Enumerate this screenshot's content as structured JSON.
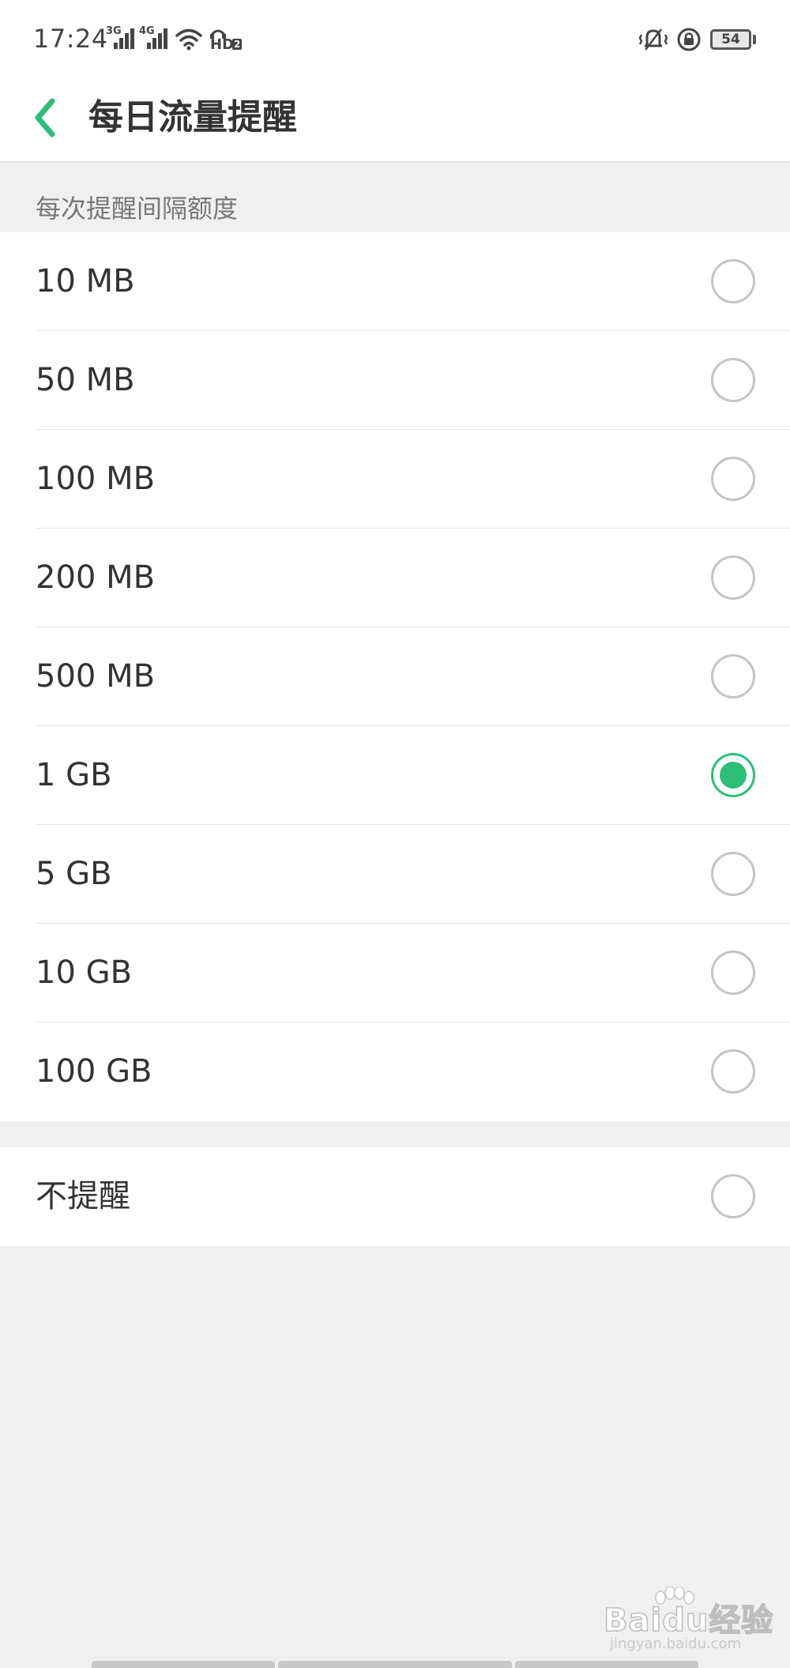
{
  "status_bar": {
    "time": "17:24",
    "signal1_label": "3G",
    "signal2_label": "4G",
    "hd_label": "HD",
    "hd_sub": "2",
    "battery_level": "54",
    "icons": [
      "signal-icon",
      "wifi-icon",
      "hd-voice-icon",
      "vibrate-icon",
      "rotation-lock-icon",
      "battery-icon"
    ]
  },
  "header": {
    "title": "每日流量提醒",
    "back_icon": "chevron-left-icon",
    "accent_color": "#2dbe78"
  },
  "section": {
    "label": "每次提醒间隔额度"
  },
  "options": [
    {
      "label": "10 MB",
      "selected": false
    },
    {
      "label": "50 MB",
      "selected": false
    },
    {
      "label": "100 MB",
      "selected": false
    },
    {
      "label": "200 MB",
      "selected": false
    },
    {
      "label": "500 MB",
      "selected": false
    },
    {
      "label": "1 GB",
      "selected": true
    },
    {
      "label": "5 GB",
      "selected": false
    },
    {
      "label": "10 GB",
      "selected": false
    },
    {
      "label": "100 GB",
      "selected": false
    }
  ],
  "no_reminder": {
    "label": "不提醒",
    "selected": false
  },
  "watermark": {
    "logo_text": "Baidu经验",
    "url_text": "jingyan.baidu.com"
  }
}
